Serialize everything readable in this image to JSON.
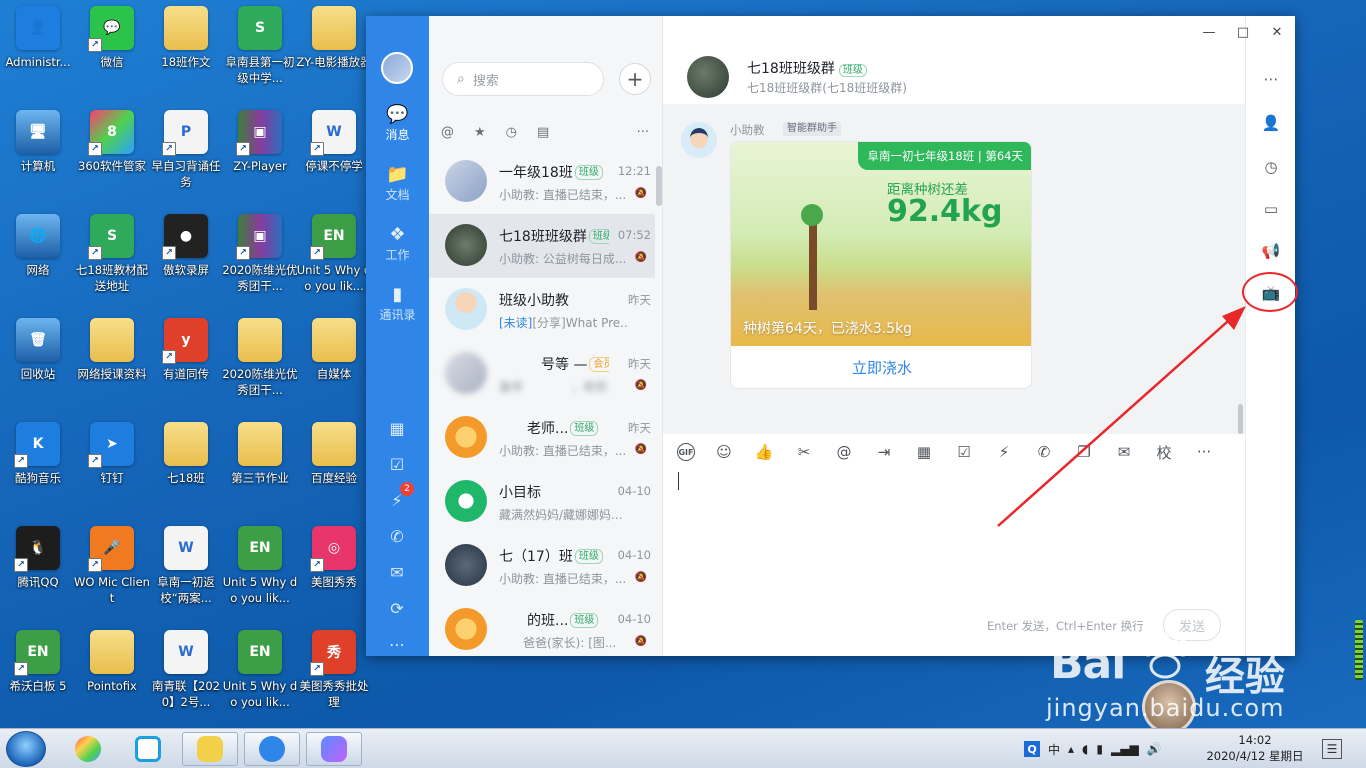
{
  "desktop": {
    "icons": [
      {
        "label": "Administr...",
        "glyph": "👤"
      },
      {
        "label": "微信",
        "glyph": "💬"
      },
      {
        "label": "18班作文",
        "glyph": ""
      },
      {
        "label": "阜南县第一初级中学...",
        "glyph": "S"
      },
      {
        "label": "ZY-电影播放器",
        "glyph": ""
      },
      {
        "label": "计算机",
        "glyph": "🖥"
      },
      {
        "label": "360软件管家",
        "glyph": "8"
      },
      {
        "label": "早自习背诵任务",
        "glyph": "P"
      },
      {
        "label": "ZY-Player",
        "glyph": "▣"
      },
      {
        "label": "停课不停学",
        "glyph": "W"
      },
      {
        "label": "网络",
        "glyph": "🌐"
      },
      {
        "label": "七18班教材配送地址",
        "glyph": "S"
      },
      {
        "label": "傲软录屏",
        "glyph": "●"
      },
      {
        "label": "2020陈维光优秀团干...",
        "glyph": "▣"
      },
      {
        "label": "Unit 5 Why do you lik...",
        "glyph": "EN"
      },
      {
        "label": "回收站",
        "glyph": "🗑"
      },
      {
        "label": "网络授课资料",
        "glyph": ""
      },
      {
        "label": "有道同传",
        "glyph": "y"
      },
      {
        "label": "2020陈维光优秀团干...",
        "glyph": ""
      },
      {
        "label": "自媒体",
        "glyph": ""
      },
      {
        "label": "酷狗音乐",
        "glyph": "K"
      },
      {
        "label": "钉钉",
        "glyph": "➤"
      },
      {
        "label": "七18班",
        "glyph": ""
      },
      {
        "label": "第三节作业",
        "glyph": ""
      },
      {
        "label": "百度经验",
        "glyph": ""
      },
      {
        "label": "腾讯QQ",
        "glyph": "🐧"
      },
      {
        "label": "WO Mic Client",
        "glyph": "🎤"
      },
      {
        "label": "阜南一初返校“两案...",
        "glyph": "W"
      },
      {
        "label": "Unit 5 Why do you lik...",
        "glyph": "EN"
      },
      {
        "label": "美图秀秀",
        "glyph": "◎"
      },
      {
        "label": "希沃白板 5",
        "glyph": "EN"
      },
      {
        "label": "Pointofix",
        "glyph": ""
      },
      {
        "label": "南青联【2020】2号...",
        "glyph": "W"
      },
      {
        "label": "Unit 5 Why do you lik...",
        "glyph": "EN"
      },
      {
        "label": "美图秀秀批处理",
        "glyph": "秀"
      }
    ]
  },
  "nav": {
    "items": [
      {
        "label": "消息",
        "icon": "message-icon",
        "glyph": "💬"
      },
      {
        "label": "文档",
        "icon": "document-icon",
        "glyph": "📁"
      },
      {
        "label": "工作",
        "icon": "work-icon",
        "glyph": "❖"
      },
      {
        "label": "通讯录",
        "icon": "contacts-icon",
        "glyph": "▮"
      }
    ],
    "small_icons": [
      {
        "icon": "calendar-icon",
        "glyph": "▦"
      },
      {
        "icon": "todo-icon",
        "glyph": "☑"
      },
      {
        "icon": "ding-icon",
        "glyph": "⚡"
      },
      {
        "icon": "phone-icon",
        "glyph": "✆"
      },
      {
        "icon": "mail-icon",
        "glyph": "✉"
      },
      {
        "icon": "org-icon",
        "glyph": "⟳"
      },
      {
        "icon": "more-icon",
        "glyph": "⋯"
      }
    ],
    "badge": "2"
  },
  "list": {
    "search_placeholder": "搜索",
    "plus": "+",
    "filters": [
      "@",
      "★",
      "◷",
      "▤"
    ],
    "more": "···",
    "conversations": [
      {
        "name": "一年级18班",
        "tag": "班级",
        "time": "12:21",
        "preview": "小助教: 直播已结束，...",
        "active": false,
        "blur": false
      },
      {
        "name": "七18班班级群",
        "tag": "班级",
        "time": "07:52",
        "preview": "小助教: 公益树每日成...",
        "active": true,
        "blur": false
      },
      {
        "name": "班级小助教",
        "tag": "",
        "time": "昨天",
        "unread": "[未读]",
        "preview": "[分享]What Pre...",
        "active": false,
        "blur": false
      },
      {
        "name": "　　　号等 —",
        "tag": "会员",
        "time": "昨天",
        "preview": "盖伴　　　　，收到",
        "active": false,
        "blur": true
      },
      {
        "name": "　　老师...",
        "tag": "班级",
        "time": "昨天",
        "preview": "小助教: 直播已结束，...",
        "active": false,
        "blur": false
      },
      {
        "name": "小目标",
        "tag": "",
        "time": "04-10",
        "preview": "藏满然妈妈/藏娜娜妈...",
        "active": false,
        "blur": false
      },
      {
        "name": "七（17）班",
        "tag": "班级",
        "time": "04-10",
        "preview": "小助教: 直播已结束，...",
        "active": false,
        "blur": false
      },
      {
        "name": "　　的班...",
        "tag": "班级",
        "time": "04-10",
        "preview": "　　爸爸(家长): [图...",
        "active": false,
        "blur": false
      }
    ]
  },
  "chat": {
    "title": "七18班班级群",
    "title_tag": "班级",
    "subtitle": "七18班班级群(七18班班级群)",
    "sender": "小助教",
    "sender_tag": "智能群助手",
    "card": {
      "banner": "阜南一初七年级18班 | 第64天",
      "remain_label": "距离种树还差",
      "weight": "92.4kg",
      "footer": "种树第64天，已浇水3.5kg",
      "button": "立即浇水"
    },
    "toolbar": [
      {
        "icon": "gif-icon",
        "glyph": "GIF"
      },
      {
        "icon": "emoji-icon",
        "glyph": "☺"
      },
      {
        "icon": "thumbs-up-icon",
        "glyph": "👍"
      },
      {
        "icon": "scissors-icon",
        "glyph": "✂"
      },
      {
        "icon": "at-icon",
        "glyph": "@"
      },
      {
        "icon": "folder-send-icon",
        "glyph": "⇥"
      },
      {
        "icon": "calendar-icon",
        "glyph": "▦"
      },
      {
        "icon": "checkbox-icon",
        "glyph": "☑"
      },
      {
        "icon": "ding-icon",
        "glyph": "⚡"
      },
      {
        "icon": "phone-icon",
        "glyph": "✆"
      },
      {
        "icon": "copy-icon",
        "glyph": "❐"
      },
      {
        "icon": "mail-icon",
        "glyph": "✉"
      },
      {
        "icon": "school-icon",
        "glyph": "校"
      },
      {
        "icon": "more-icon",
        "glyph": "···"
      }
    ],
    "send_hint": "Enter 发送，Ctrl+Enter 换行",
    "send_button": "发送"
  },
  "sidebar": {
    "icons": [
      {
        "icon": "more-options-icon",
        "glyph": "⋯"
      },
      {
        "icon": "add-member-icon",
        "glyph": "👤"
      },
      {
        "icon": "history-icon",
        "glyph": "◷"
      },
      {
        "icon": "files-icon",
        "glyph": "▭"
      },
      {
        "icon": "announcement-icon",
        "glyph": "📢"
      },
      {
        "icon": "live-tv-icon",
        "glyph": "📺"
      }
    ]
  },
  "window_controls": {
    "minimize": "—",
    "maximize": "□",
    "close": "✕"
  },
  "watermark": {
    "brand_a": "Bai",
    "brand_b": "经验",
    "url": "jingyan.baidu.com"
  },
  "taskbar": {
    "ime": "中",
    "time": "14:02",
    "date": "2020/4/12 星期日"
  },
  "colors": {
    "accent": "#2f86e8",
    "annotation": "#e8282a",
    "class_tag": "#2fa96a"
  }
}
